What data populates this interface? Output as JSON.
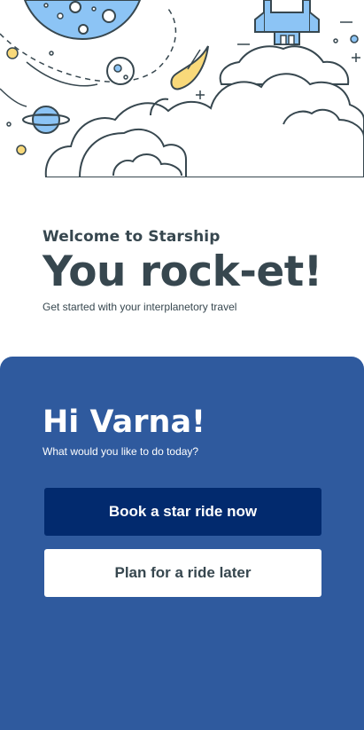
{
  "welcome": {
    "kicker": "Welcome to Starship",
    "title": "You rock-et!",
    "subtitle": "Get started with your interplanetory travel"
  },
  "panel": {
    "greeting": "Hi Varna!",
    "question": "What would you like to do today?",
    "primary_button": "Book a star ride now",
    "secondary_button": "Plan for a ride later"
  },
  "colors": {
    "panel_bg": "#2f5a9e",
    "primary_button_bg": "#022a6e",
    "text_dark": "#37474f",
    "illustration_blue": "#8cc4f5",
    "illustration_yellow": "#f9d97a"
  },
  "icons": [
    "planet-illustration",
    "moon-illustration",
    "comet-illustration",
    "rocket-illustration",
    "cloud-illustration",
    "star-icon"
  ]
}
